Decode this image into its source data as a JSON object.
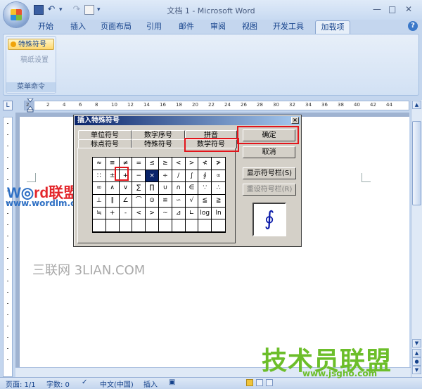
{
  "window": {
    "title": "文档 1 - Microsoft Word"
  },
  "ribbon_tabs": [
    "开始",
    "插入",
    "页面布局",
    "引用",
    "邮件",
    "审阅",
    "视图",
    "开发工具",
    "加载项"
  ],
  "active_tab_index": 8,
  "ribbon_group": {
    "button1": "特殊符号",
    "button2": "稿纸设置",
    "label": "菜单命令"
  },
  "ruler_numbers": [
    "2",
    "2",
    "4",
    "6",
    "8",
    "10",
    "12",
    "14",
    "16",
    "18",
    "20",
    "22",
    "24",
    "26",
    "28",
    "30",
    "32",
    "34",
    "36",
    "38",
    "40",
    "42",
    "44"
  ],
  "watermarks": {
    "word_prefix": "W",
    "word_suffix": "rd联盟",
    "word_url": "www.wordlm.com",
    "sanlian": "三联网 3LIAN.COM",
    "jishu": "技术员联盟",
    "jsgho": "www.jsgho.com"
  },
  "dialog": {
    "title": "插入特殊符号",
    "tabs_row1": [
      "单位符号",
      "数字序号",
      "拼音"
    ],
    "tabs_row2": [
      "标点符号",
      "特殊符号",
      "数学符号"
    ],
    "active_tab": "数学符号",
    "symbols": [
      "≈",
      "≡",
      "≠",
      "=",
      "≤",
      "≥",
      "<",
      ">",
      "≮",
      "≯",
      "∷",
      "±",
      "+",
      "−",
      "×",
      "÷",
      "/",
      "∫",
      "∮",
      "∝",
      "∞",
      "∧",
      "∨",
      "∑",
      "∏",
      "∪",
      "∩",
      "∈",
      "∵",
      "∴",
      "⊥",
      "∥",
      "∠",
      "⌒",
      "⊙",
      "≌",
      "∽",
      "√",
      "≦",
      "≧",
      "≒",
      "+",
      "-",
      "<",
      ">",
      "~",
      "⊿",
      "∟",
      "log",
      "ln",
      "",
      "",
      "",
      "",
      "",
      "",
      "",
      "",
      "",
      ""
    ],
    "selected_index": 14,
    "buttons": {
      "ok": "确定",
      "cancel": "取消",
      "show_bar": "显示符号栏(S)",
      "reset_bar": "重设符号栏(R)"
    },
    "preview_symbol": "∮"
  },
  "status": {
    "page": "页面: 1/1",
    "words": "字数: 0",
    "language": "中文(中国)",
    "mode": "插入"
  },
  "colors": {
    "accent": "#15428b",
    "highlight": "#e2141b"
  }
}
